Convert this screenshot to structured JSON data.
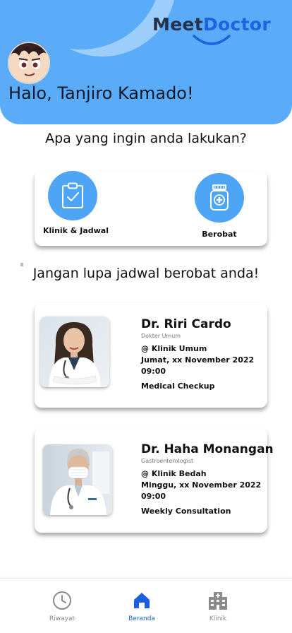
{
  "brand": {
    "part1": "Meet",
    "part2": "Doctor"
  },
  "header": {
    "greeting": "Halo, Tanjiro Kamado!"
  },
  "question": "Apa yang ingin anda lakukan?",
  "actions": [
    {
      "label": "Klinik & Jadwal",
      "icon": "clipboard-check-icon"
    },
    {
      "label": "Berobat",
      "icon": "medicine-bottle-icon"
    }
  ],
  "reminder": "Jangan lupa jadwal berobat anda!",
  "appointments": [
    {
      "doctor": "Dr. Riri Cardo",
      "specialty": "Dokter Umum",
      "clinic": "@ Klinik Umum",
      "date": "Jumat, xx November 2022",
      "time": "09:00",
      "note": "Medical Checkup"
    },
    {
      "doctor": "Dr. Haha Monangan",
      "specialty": "Gastroenterologist",
      "clinic": "@ Klinik Bedah",
      "date": "Minggu, xx November 2022",
      "time": "09:00",
      "note": "Weekly Consultation"
    }
  ],
  "nav": [
    {
      "label": "Riwayat",
      "icon": "clock-icon",
      "active": false
    },
    {
      "label": "Beranda",
      "icon": "home-icon",
      "active": true
    },
    {
      "label": "Klinik",
      "icon": "hospital-icon",
      "active": false
    }
  ],
  "colors": {
    "header": "#5aabf8",
    "accent_circle": "#4ea4f5",
    "brand_dark": "#24324d",
    "brand_blue": "#1f63e0",
    "nav_active": "#1b5fe0"
  }
}
